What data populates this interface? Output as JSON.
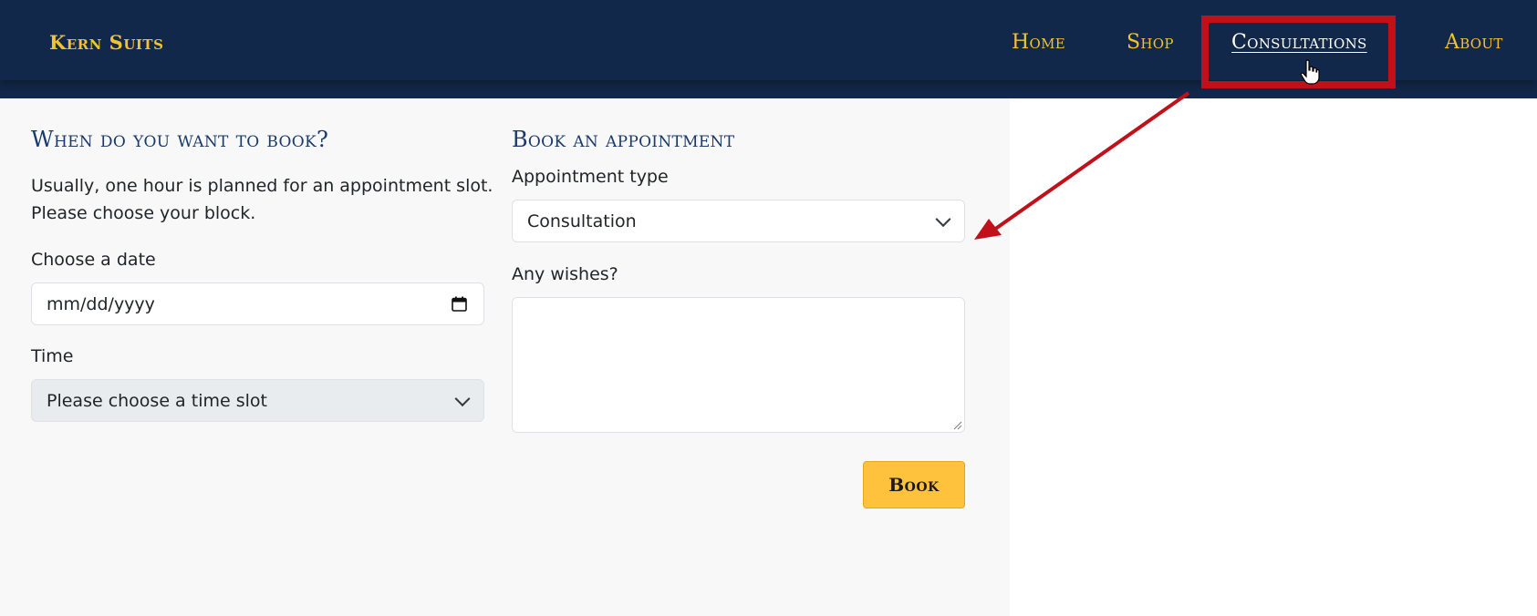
{
  "navbar": {
    "brand": "Kern Suits",
    "links": [
      {
        "label": "Home"
      },
      {
        "label": "Shop"
      },
      {
        "label": "Consultations",
        "active": true
      },
      {
        "label": "About"
      }
    ]
  },
  "colors": {
    "navbar_bg": "#12284a",
    "nav_link": "#f1c232",
    "nav_active": "#ffffff",
    "highlight": "#c0111a",
    "heading": "#1a3a6b",
    "button_bg": "#ffc23d"
  },
  "left_section": {
    "title": "When do you want to book?",
    "intro_line1": "Usually, one hour is planned for an appointment slot.",
    "intro_line2": "Please choose your block.",
    "date_label": "Choose a date",
    "date_placeholder": "mm/dd/yyyy",
    "time_label": "Time",
    "time_value": "Please choose a time slot"
  },
  "right_section": {
    "title": "Book an appointment",
    "type_label": "Appointment type",
    "type_value": "Consultation",
    "wishes_label": "Any wishes?",
    "wishes_value": "",
    "book_button": "Book"
  },
  "icons": {
    "calendar": "calendar-icon",
    "chevron": "chevron-down-icon",
    "cursor": "hand-pointer-icon"
  }
}
